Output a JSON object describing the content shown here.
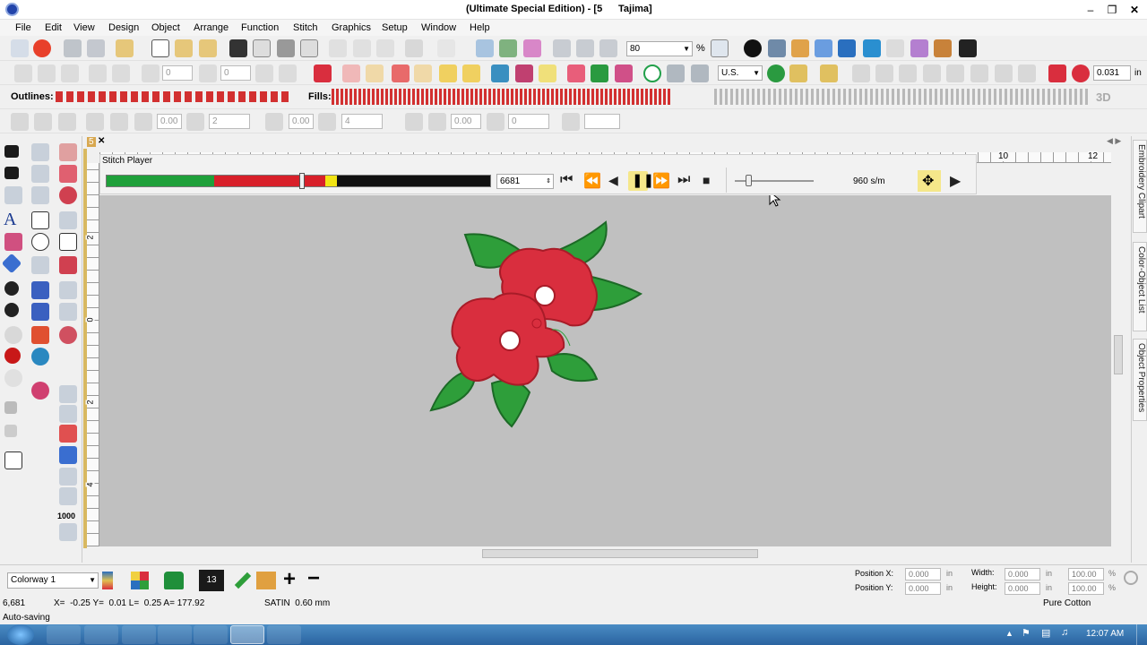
{
  "window": {
    "title_left": "(Ultimate Special Edition) - [5",
    "title_right": "Tajima]",
    "minimize_icon": "minimize-icon",
    "maximize_icon": "restore-icon",
    "close_icon": "close-icon"
  },
  "menu": [
    "File",
    "Edit",
    "View",
    "Design",
    "Object",
    "Arrange",
    "Function",
    "Stitch",
    "Graphics",
    "Setup",
    "Window",
    "Help"
  ],
  "toolbar": {
    "zoom_value": "80",
    "zoom_unit": "%",
    "units_value": "U.S.",
    "stitch_length_value": "0.031",
    "stitch_length_unit": "in",
    "outlines_label": "Outlines:",
    "fills_label": "Fills:",
    "spin_values": [
      "0",
      "0",
      "0.00",
      "2",
      "0.00",
      "4",
      "0.00",
      "0"
    ]
  },
  "document_tab": {
    "label": "5",
    "close": "✕"
  },
  "rulers": {
    "h_ticks": [
      "10",
      "12"
    ],
    "v_ticks": [
      "2",
      "0",
      "2",
      "4"
    ]
  },
  "stitch_player": {
    "title": "Stitch Player",
    "stitch_count": "6681",
    "speed": "960 s/m",
    "progress": 0.51,
    "track_colors": [
      "#1fa03a",
      "#d8202a",
      "#f2e414",
      "#111111"
    ],
    "buttons": [
      "first-icon",
      "rewind-icon",
      "step-back-icon",
      "pause-icon",
      "fast-forward-icon",
      "last-icon",
      "stop-icon"
    ],
    "play_next": "play-next-icon",
    "move_handle": "move-icon"
  },
  "side_tabs": [
    "Embroidery Clipart",
    "Color-Object List",
    "Object Properties"
  ],
  "bottom": {
    "colorway": "Colorway 1",
    "thread_count": "13",
    "position_x_label": "Position X:",
    "position_y_label": "Position Y:",
    "position_x": "0.000",
    "position_y": "0.000",
    "width_label": "Width:",
    "height_label": "Height:",
    "width": "0.000",
    "height": "0.000",
    "unit": "in",
    "scale_w": "100.00",
    "scale_h": "100.00",
    "pct": "%"
  },
  "status": {
    "stitches": "6,681",
    "coords": "X=  -0.25 Y=  0.01 L=  0.25 A= 177.92",
    "stitch_type": "SATIN  0.60 mm",
    "thread": "Pure Cotton",
    "message": "Auto-saving"
  },
  "taskbar": {
    "clock": "12:07 AM"
  },
  "colors": {
    "leaf": "#2e9e3a",
    "petal": "#d92e3e",
    "canvas": "#c0c0c0"
  }
}
